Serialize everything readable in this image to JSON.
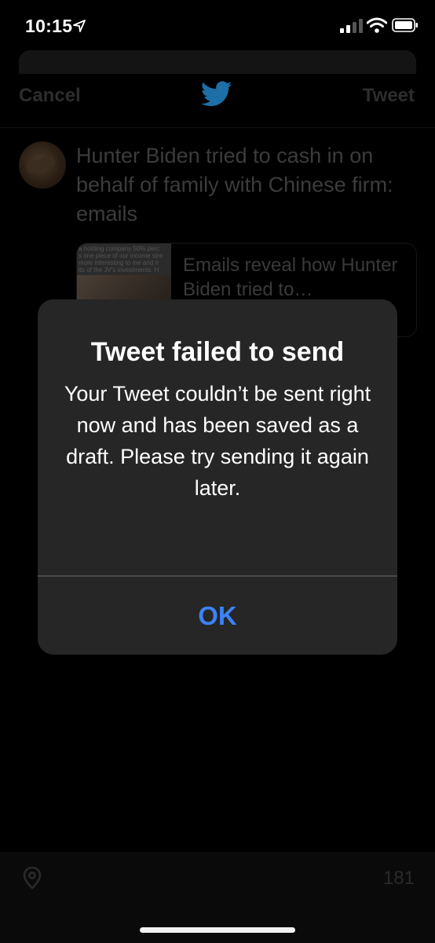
{
  "status_bar": {
    "time": "10:15",
    "icons": [
      "location-arrow-icon",
      "cellular-signal-icon",
      "wifi-icon",
      "battery-icon"
    ]
  },
  "compose": {
    "cancel_label": "Cancel",
    "tweet_label": "Tweet",
    "logo_icon": "twitter-bird-icon",
    "draft_text": "Hunter Biden tried to cash in on behalf of family with Chinese firm: emails",
    "link_card": {
      "title": "Emails reveal how Hunter Biden tried to…",
      "thumbnail_text_lines": [
        "a holding company 50% perc",
        "s one piece of our income stre",
        "more interesting to me and n",
        "its of the JV's investments. H"
      ]
    },
    "char_remaining": "181",
    "location_icon": "location-pin-icon"
  },
  "alert": {
    "title": "Tweet failed to send",
    "message": "Your Tweet couldn’t be sent right now and has been saved as a draft. Please try sending it again later.",
    "ok_label": "OK"
  },
  "colors": {
    "background": "#000000",
    "alert_background": "#262626",
    "ok_button": "#3b82f6",
    "twitter_blue": "#1d9bf0"
  }
}
